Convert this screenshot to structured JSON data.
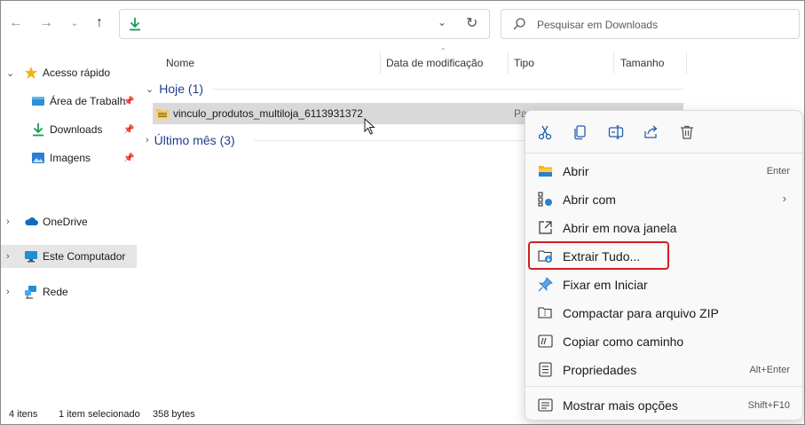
{
  "toolbar": {
    "back_icon": "arrow-left-icon",
    "forward_icon": "arrow-right-icon",
    "recent_icon": "chevron-down-icon",
    "up_icon": "arrow-up-icon",
    "address_icon": "download-icon",
    "search_placeholder": "Pesquisar em Downloads"
  },
  "sidebar": {
    "items": [
      {
        "label": "Acesso rápido",
        "icon": "star-icon"
      },
      {
        "label": "Área de Trabalh",
        "icon": "desktop-icon",
        "pinned": true
      },
      {
        "label": "Downloads",
        "icon": "download-icon",
        "pinned": true
      },
      {
        "label": "Imagens",
        "icon": "image-icon",
        "pinned": true
      },
      {
        "label": "OneDrive",
        "icon": "cloud-icon"
      },
      {
        "label": "Este Computador",
        "icon": "monitor-icon",
        "selected": true
      },
      {
        "label": "Rede",
        "icon": "network-icon"
      }
    ]
  },
  "main": {
    "columns": [
      "Nome",
      "Data de modificação",
      "Tipo",
      "Tamanho"
    ],
    "groups": [
      {
        "label": "Hoje (1)",
        "expanded": true
      },
      {
        "label": "Último mês (3)",
        "expanded": false
      }
    ],
    "file": {
      "name": "vinculo_produtos_multiloja_6113931372",
      "type_partial": "Pa"
    }
  },
  "status": {
    "items": "4 itens",
    "selected": "1 item selecionado",
    "size": "358 bytes"
  },
  "context_menu": {
    "quick_actions": [
      "cut-icon",
      "copy-icon",
      "rename-icon",
      "share-icon",
      "trash-icon"
    ],
    "items": [
      {
        "label": "Abrir",
        "key": "Enter",
        "icon": "folder-open-icon"
      },
      {
        "label": "Abrir com",
        "key": "",
        "icon": "open-with-icon",
        "submenu": true
      },
      {
        "label": "Abrir em nova janela",
        "key": "",
        "icon": "new-window-icon"
      },
      {
        "label": "Extrair Tudo...",
        "key": "",
        "icon": "extract-icon",
        "highlighted": true
      },
      {
        "label": "Fixar em Iniciar",
        "key": "",
        "icon": "pin-icon"
      },
      {
        "label": "Compactar para arquivo ZIP",
        "key": "",
        "icon": "zip-icon"
      },
      {
        "label": "Copiar como caminho",
        "key": "",
        "icon": "path-icon"
      },
      {
        "label": "Propriedades",
        "key": "Alt+Enter",
        "icon": "properties-icon"
      },
      {
        "label": "Mostrar mais opções",
        "key": "Shift+F10",
        "icon": "more-options-icon"
      }
    ]
  },
  "colors": {
    "accent": "#0067c0",
    "highlight_border": "#d21e1e",
    "group_text": "#1f3f8a",
    "selection": "#d9d9d9"
  }
}
